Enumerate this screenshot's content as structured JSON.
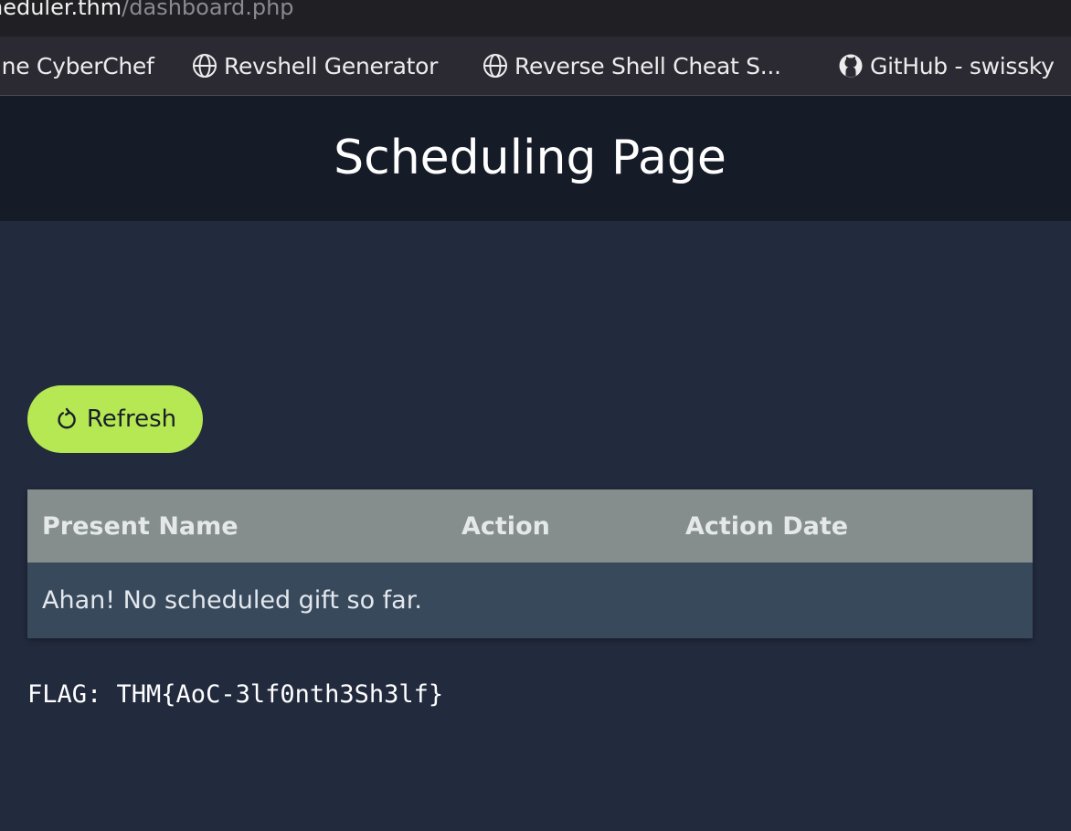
{
  "browser": {
    "url_host": "heduler.thm",
    "url_path": "/dashboard.php",
    "bookmarks": [
      {
        "label": "ine CyberChef",
        "icon": "none"
      },
      {
        "label": "Revshell Generator",
        "icon": "globe-icon"
      },
      {
        "label": "Reverse Shell Cheat S...",
        "icon": "globe-icon"
      },
      {
        "label": "GitHub - swissky",
        "icon": "github-icon"
      }
    ]
  },
  "page": {
    "title": "Scheduling Page",
    "refresh_label": "Refresh",
    "table": {
      "headers": [
        "Present Name",
        "Action",
        "Action Date"
      ],
      "empty_message": "Ahan! No scheduled gift so far."
    },
    "flag": "FLAG: THM{AoC-3lf0nth3Sh3lf}"
  },
  "colors": {
    "background": "#222a3e",
    "header_bg": "#161b28",
    "accent": "#b5e853",
    "table_header": "#858d8d",
    "table_row": "#37495b"
  }
}
